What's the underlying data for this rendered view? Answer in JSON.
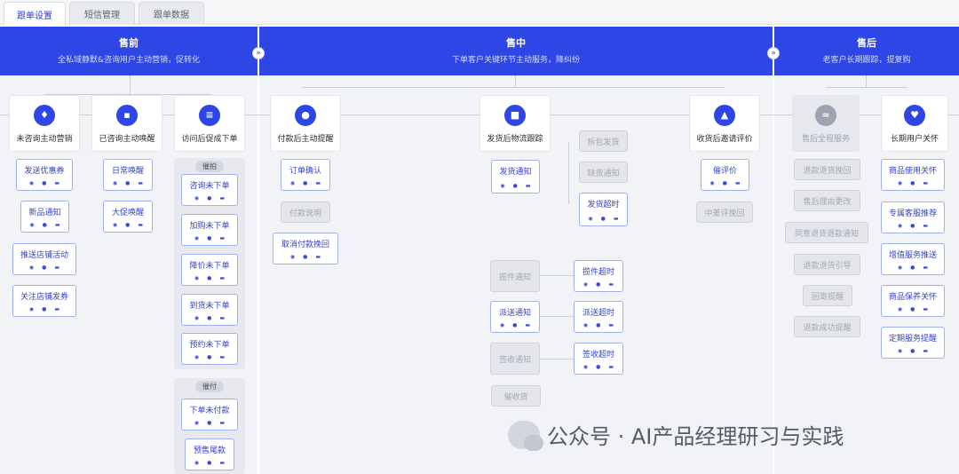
{
  "tabs": [
    {
      "label": "跟单设置",
      "active": true
    },
    {
      "label": "短信管理",
      "active": false
    },
    {
      "label": "跟单数据",
      "active": false
    }
  ],
  "stages": {
    "pre": {
      "title": "售前",
      "subtitle": "全私域静默&咨询用户主动营销，促转化"
    },
    "mid": {
      "title": "售中",
      "subtitle": "下单客户关键环节主动服务，降纠纷"
    },
    "post": {
      "title": "售后",
      "subtitle": "老客户长期跟踪，提复购"
    }
  },
  "categories": {
    "c1": "未咨询主动营销",
    "c2": "已咨询主动唤醒",
    "c3": "访问后促成下单",
    "c4": "付款后主动提醒",
    "c5": "发货后物流跟踪",
    "c6": "收货后邀请评价",
    "c7": "售后全程服务",
    "c8": "长期用户关怀"
  },
  "groups": {
    "g1": "催拍",
    "g2": "催付"
  },
  "cards": {
    "k1": "发送优惠券",
    "k2": "新品通知",
    "k3": "推送店铺活动",
    "k4": "关注店铺发券",
    "k5": "日常唤醒",
    "k6": "大促唤醒",
    "k7": "咨询未下单",
    "k8": "加购未下单",
    "k9": "降价未下单",
    "k10": "到货未下单",
    "k11": "预约未下单",
    "k12": "下单未付款",
    "k13": "预售尾款",
    "k14": "订单确认",
    "k15": "付款说明",
    "k16": "取消付款挽回",
    "k17": "发货通知",
    "k18": "拆包发货",
    "k19": "缺货通知",
    "k20": "发货超时",
    "k21": "揽件通知",
    "k22": "揽件超时",
    "k23": "派送通知",
    "k24": "派送超时",
    "k25": "签收通知",
    "k26": "签收超时",
    "k27": "催收货",
    "k28": "催评价",
    "k29": "中差评挽回",
    "k30": "退款退货挽回",
    "k31": "售后理由更改",
    "k32": "同意退货退款通知",
    "k33": "退款退货引导",
    "k34": "回寄提醒",
    "k35": "退款成功提醒",
    "k36": "商品使用关怀",
    "k37": "专属客服推荐",
    "k38": "增值服务推送",
    "k39": "商品保养关怀",
    "k40": "定期服务提醒"
  },
  "card_icons": [
    "power-icon",
    "chat-icon",
    "sms-icon"
  ],
  "watermark": "公众号 · AI产品经理研习与实践",
  "colors": {
    "banner": "#2e46e6",
    "accent": "#3542c9",
    "card_border": "#9fb0f3",
    "disabled": "#e4e6eb"
  }
}
